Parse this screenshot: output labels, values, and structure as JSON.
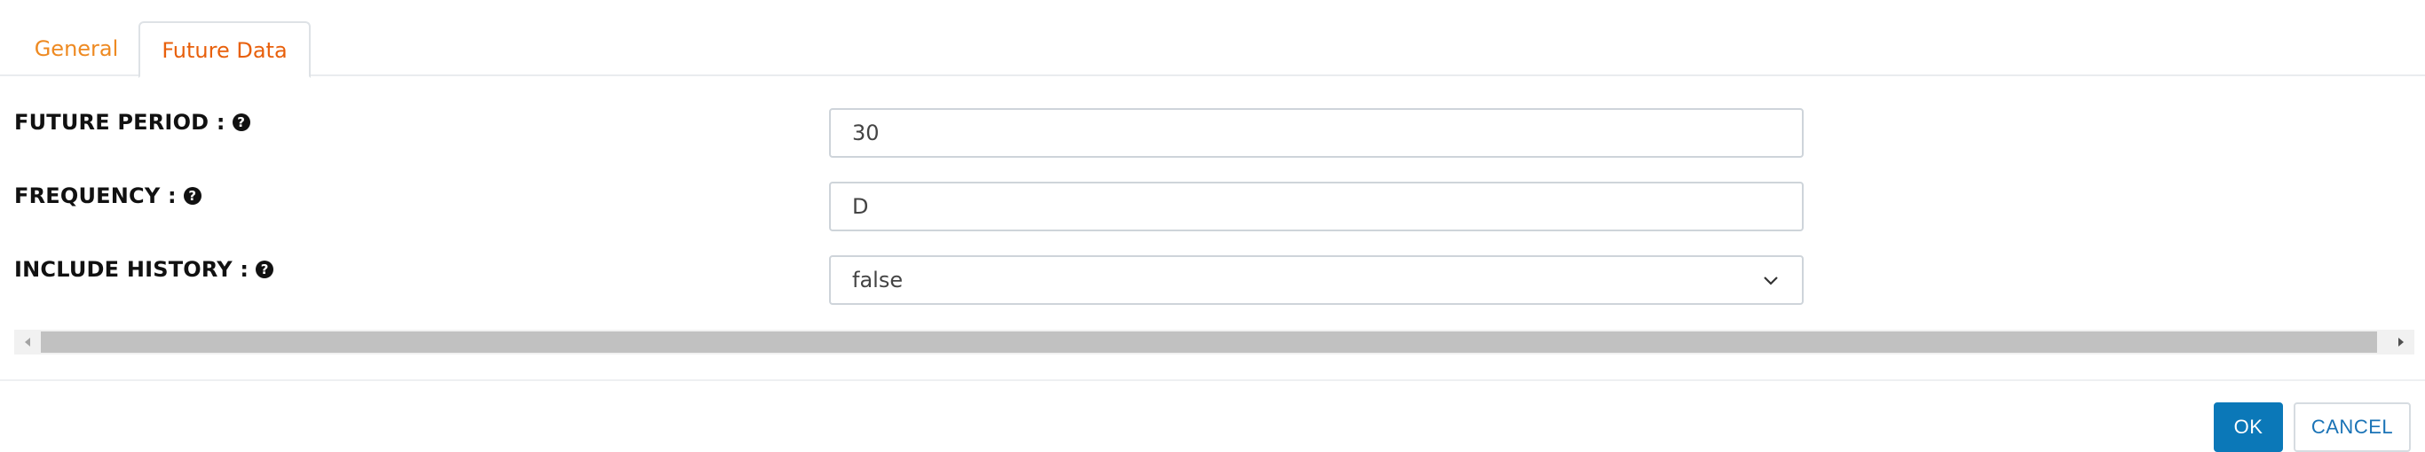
{
  "tabs": [
    {
      "label": "General",
      "active": false
    },
    {
      "label": "Future Data",
      "active": true
    }
  ],
  "form": {
    "future_period": {
      "label": "FUTURE PERIOD :",
      "value": "30"
    },
    "frequency": {
      "label": "FREQUENCY :",
      "value": "D"
    },
    "include_history": {
      "label": "INCLUDE HISTORY :",
      "value": "false",
      "options": [
        "false"
      ]
    }
  },
  "icons": {
    "help": "question-circle-icon",
    "select_arrow": "chevron-down-icon",
    "scroll_left": "triangle-left-icon",
    "scroll_right": "triangle-right-icon"
  },
  "footer": {
    "ok_label": "OK",
    "cancel_label": "CANCEL"
  },
  "colors": {
    "tab_inactive": "#ee8a22",
    "tab_active": "#e8600c",
    "primary": "#0b78b8"
  }
}
